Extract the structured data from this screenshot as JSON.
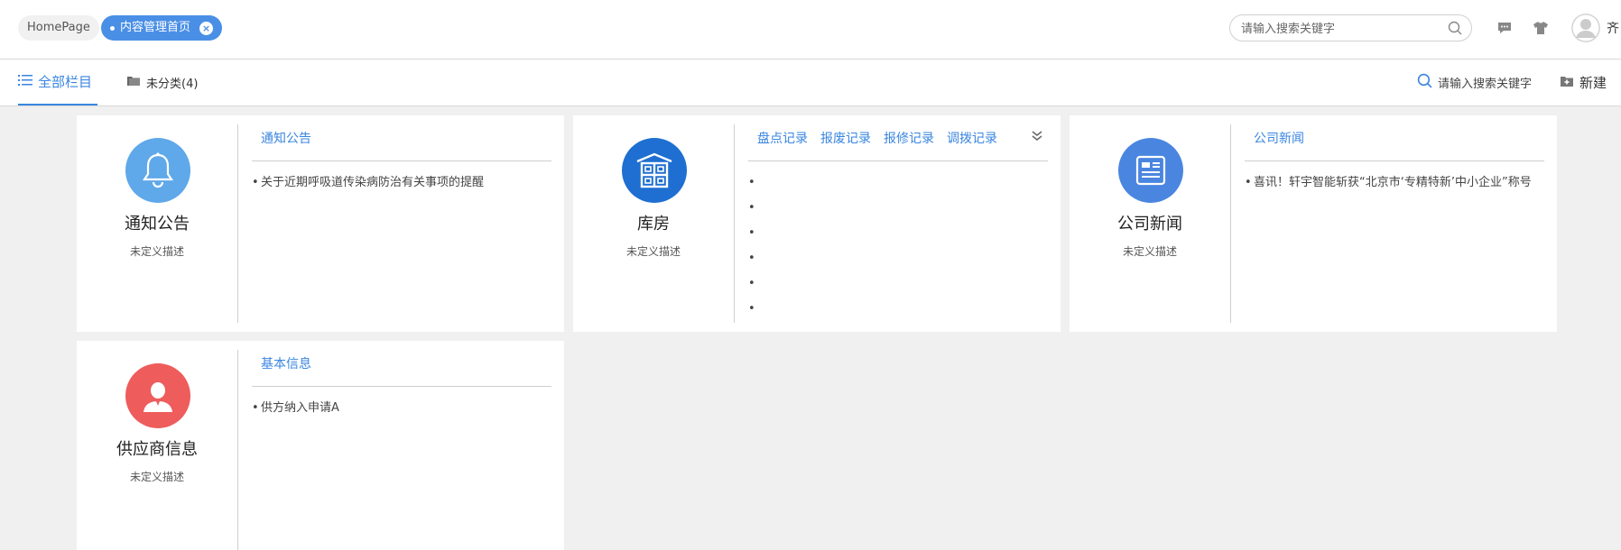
{
  "topbar": {
    "tabs": [
      {
        "label": "HomePage"
      },
      {
        "label": "内容管理首页"
      }
    ],
    "search_placeholder": "请输入搜索关键字",
    "username": "齐"
  },
  "subbar": {
    "all_label": "全部栏目",
    "uncategorized_label": "未分类(4)",
    "search_label": "请输入搜索关键字",
    "new_label": "新建"
  },
  "colors": {
    "accent": "#3a86e0",
    "notice_icon": "#5fa8ea",
    "warehouse_icon": "#1e6fd1",
    "news_icon": "#4a86e0",
    "supplier_icon": "#ee5c5c"
  },
  "cards": [
    {
      "title": "通知公告",
      "desc": "未定义描述",
      "icon": "bell-icon",
      "tabs": [
        "通知公告"
      ],
      "items": [
        "关于近期呼吸道传染病防治有关事项的提醒"
      ]
    },
    {
      "title": "库房",
      "desc": "未定义描述",
      "icon": "warehouse-icon",
      "tabs": [
        "盘点记录",
        "报废记录",
        "报修记录",
        "调拨记录"
      ],
      "items": [
        "",
        "",
        "",
        "",
        "",
        ""
      ]
    },
    {
      "title": "公司新闻",
      "desc": "未定义描述",
      "icon": "newspaper-icon",
      "tabs": [
        "公司新闻"
      ],
      "items": [
        "喜讯！轩宇智能斩获“北京市‘专精特新’中小企业”称号"
      ]
    },
    {
      "title": "供应商信息",
      "desc": "未定义描述",
      "icon": "person-icon",
      "tabs": [
        "基本信息"
      ],
      "items": [
        "供方纳入申请A"
      ]
    }
  ]
}
